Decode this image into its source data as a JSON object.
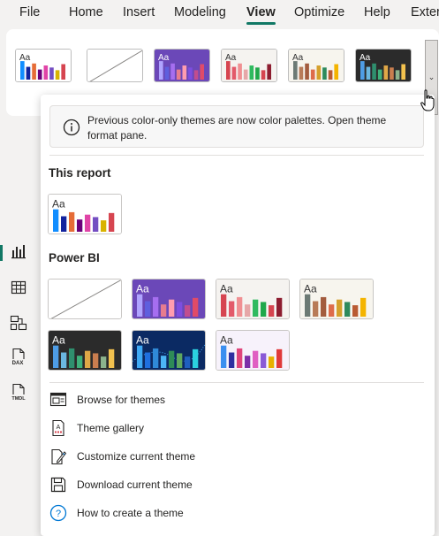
{
  "menu": [
    "File",
    "Home",
    "Insert",
    "Modeling",
    "View",
    "Optimize",
    "Help",
    "External"
  ],
  "active_menu": "View",
  "ribbon_themes": [
    {
      "name": "default",
      "aa": "Aa",
      "bg": "#ffffff",
      "fg": "#333333",
      "bars": [
        "#118dff",
        "#12239e",
        "#e66c37",
        "#6b007b",
        "#e044a7",
        "#744ec2",
        "#d9b300",
        "#d64550"
      ]
    },
    {
      "name": "blank",
      "aa": "",
      "bg": "#ffffff",
      "fg": "#333333",
      "bars": []
    },
    {
      "name": "purple",
      "aa": "Aa",
      "bg": "#6b48b8",
      "fg": "#ffffff",
      "bars": [
        "#b0a4ff",
        "#5f5fde",
        "#a66ef0",
        "#e77c8f",
        "#ff9daf",
        "#7d4ee0",
        "#c14d8f",
        "#e04b68"
      ]
    },
    {
      "name": "pink",
      "aa": "Aa",
      "bg": "#f5f3f0",
      "fg": "#333333",
      "bars": [
        "#d64550",
        "#e35a6a",
        "#f08f92",
        "#e6a7a8",
        "#2fba5f",
        "#1fa84a",
        "#d64550",
        "#8d1d30"
      ]
    },
    {
      "name": "earth",
      "aa": "Aa",
      "bg": "#f7f5ee",
      "fg": "#333333",
      "bars": [
        "#6c7a74",
        "#b87b58",
        "#a35c3e",
        "#de6c4b",
        "#d5a02c",
        "#2e8a5c",
        "#b95b33",
        "#f4b400"
      ]
    },
    {
      "name": "dark",
      "aa": "Aa",
      "bg": "#2b2b2b",
      "fg": "#ffffff",
      "bars": [
        "#4e9de6",
        "#6bb7e0",
        "#2f8f6e",
        "#3fb07a",
        "#e0a847",
        "#c97e4f",
        "#8cb38d",
        "#f2c14e"
      ]
    }
  ],
  "info_text": "Previous color-only themes are now color palettes. Open theme format pane.",
  "this_report_label": "This report",
  "this_report_theme": {
    "name": "current",
    "aa": "Aa",
    "bg": "#ffffff",
    "fg": "#333333",
    "bars": [
      "#118dff",
      "#12239e",
      "#e66c37",
      "#6b007b",
      "#e044a7",
      "#744ec2",
      "#d9b300",
      "#d64550"
    ]
  },
  "power_bi_label": "Power BI",
  "power_bi_themes": [
    {
      "name": "blank",
      "aa": "",
      "bg": "#ffffff",
      "fg": "#333333",
      "bars": []
    },
    {
      "name": "purple",
      "aa": "Aa",
      "bg": "#6b48b8",
      "fg": "#ffffff",
      "bars": [
        "#b0a4ff",
        "#5f5fde",
        "#a66ef0",
        "#e77c8f",
        "#ff9daf",
        "#7d4ee0",
        "#c14d8f",
        "#e04b68"
      ]
    },
    {
      "name": "pink",
      "aa": "Aa",
      "bg": "#f5f3f0",
      "fg": "#333333",
      "bars": [
        "#d64550",
        "#e35a6a",
        "#f08f92",
        "#e6a7a8",
        "#2fba5f",
        "#1fa84a",
        "#d64550",
        "#8d1d30"
      ]
    },
    {
      "name": "earth",
      "aa": "Aa",
      "bg": "#f7f5ee",
      "fg": "#333333",
      "bars": [
        "#6c7a74",
        "#b87b58",
        "#a35c3e",
        "#de6c4b",
        "#d5a02c",
        "#2e8a5c",
        "#b95b33",
        "#f4b400"
      ]
    },
    {
      "name": "dark",
      "aa": "Aa",
      "bg": "#2b2b2b",
      "fg": "#ffffff",
      "bars": [
        "#4e9de6",
        "#6bb7e0",
        "#2f8f6e",
        "#3fb07a",
        "#e0a847",
        "#c97e4f",
        "#8cb38d",
        "#f2c14e"
      ]
    },
    {
      "name": "night",
      "aa": "Aa",
      "bg": "#0b2a63",
      "fg": "#ffffff",
      "bars": [
        "#3fa9f5",
        "#1f6fe0",
        "#2f8ad8",
        "#4cb5f5",
        "#2e8b57",
        "#5fa85f",
        "#1f5fbf",
        "#2bd1e0"
      ]
    },
    {
      "name": "pastel",
      "aa": "Aa",
      "bg": "#f7f2fb",
      "fg": "#333333",
      "bars": [
        "#3b8ff0",
        "#2f2fa0",
        "#e0457b",
        "#7c2fa8",
        "#e05fc2",
        "#8a5ad6",
        "#e8b000",
        "#e03a3a"
      ]
    }
  ],
  "actions": [
    {
      "label": "Browse for themes",
      "icon": "browse-themes-icon"
    },
    {
      "label": "Theme gallery",
      "icon": "theme-gallery-icon"
    },
    {
      "label": "Customize current theme",
      "icon": "customize-theme-icon"
    },
    {
      "label": "Download current theme",
      "icon": "download-theme-icon"
    },
    {
      "label": "How to create a theme",
      "icon": "help-icon"
    }
  ],
  "rail_icons": [
    "report-view-icon",
    "table-view-icon",
    "model-view-icon",
    "dax-query-view-icon",
    "tmdl-view-icon"
  ],
  "rail_labels": [
    "DAX",
    "TMDL"
  ]
}
